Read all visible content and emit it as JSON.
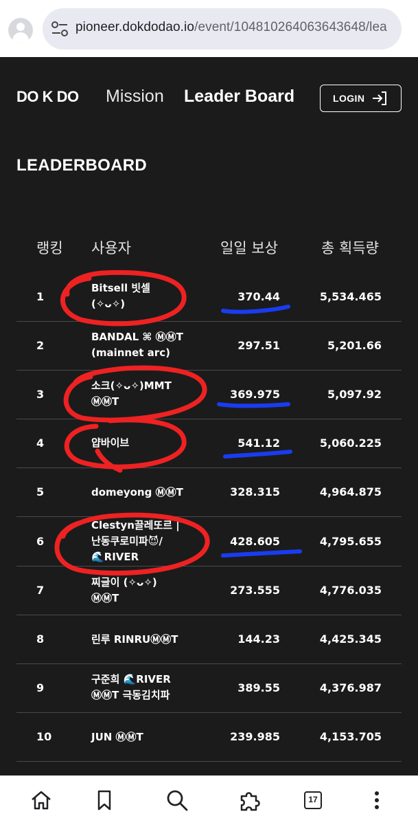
{
  "browser": {
    "url_host": "pioneer.dokdodao.io",
    "url_path": "/event/104810264063643648/lea",
    "profile_icon": "account-circle-icon",
    "site_settings_icon": "tune-icon"
  },
  "header": {
    "logo": "DO K DO",
    "nav": {
      "mission": "Mission",
      "leaderboard": "Leader Board"
    },
    "login_label": "LOGIN",
    "login_icon": "login-arrow-icon"
  },
  "page": {
    "title": "LEADERBOARD"
  },
  "table": {
    "columns": {
      "rank": "랭킹",
      "user": "사용자",
      "daily": "일일 보상",
      "total": "총 획득량"
    },
    "rows": [
      {
        "rank": "1",
        "user": "Bitsell 빗셀\n(✧ᴗ✧)",
        "daily": "370.44",
        "total": "5,534.465"
      },
      {
        "rank": "2",
        "user": "BANDAL ⌘ ⓂⓂT\n(mainnet arc)",
        "daily": "297.51",
        "total": "5,201.66"
      },
      {
        "rank": "3",
        "user": "소크(✧ᴗ✧)MMT\nⓂⓂT",
        "daily": "369.975",
        "total": "5,097.92"
      },
      {
        "rank": "4",
        "user": "얍바이브",
        "daily": "541.12",
        "total": "5,060.225"
      },
      {
        "rank": "5",
        "user": "domeyong ⓂⓂT",
        "daily": "328.315",
        "total": "4,964.875"
      },
      {
        "rank": "6",
        "user": "Clestyn끌레또르 |\n난동쿠로미파😈/\n🌊RIVER",
        "daily": "428.605",
        "total": "4,795.655"
      },
      {
        "rank": "7",
        "user": "찌글이 (✧ᴗ✧)\nⓂⓂT",
        "daily": "273.555",
        "total": "4,776.035"
      },
      {
        "rank": "8",
        "user": "린루 RINRUⓂⓂT",
        "daily": "144.23",
        "total": "4,425.345"
      },
      {
        "rank": "9",
        "user": "구준희 🌊RIVER\nⓂⓂT 극동김치파",
        "daily": "389.55",
        "total": "4,376.987"
      },
      {
        "rank": "10",
        "user": "JUN ⓂⓂT",
        "daily": "239.985",
        "total": "4,153.705"
      }
    ]
  },
  "annotations": {
    "circle_color": "#ee2222",
    "underline_color": "#1a3cf0"
  },
  "bottom_nav": {
    "home_icon": "home-icon",
    "bookmark_icon": "bookmark-icon",
    "search_icon": "search-icon",
    "extensions_icon": "puzzle-icon",
    "tab_count": "17",
    "menu_icon": "more-vert-icon"
  }
}
